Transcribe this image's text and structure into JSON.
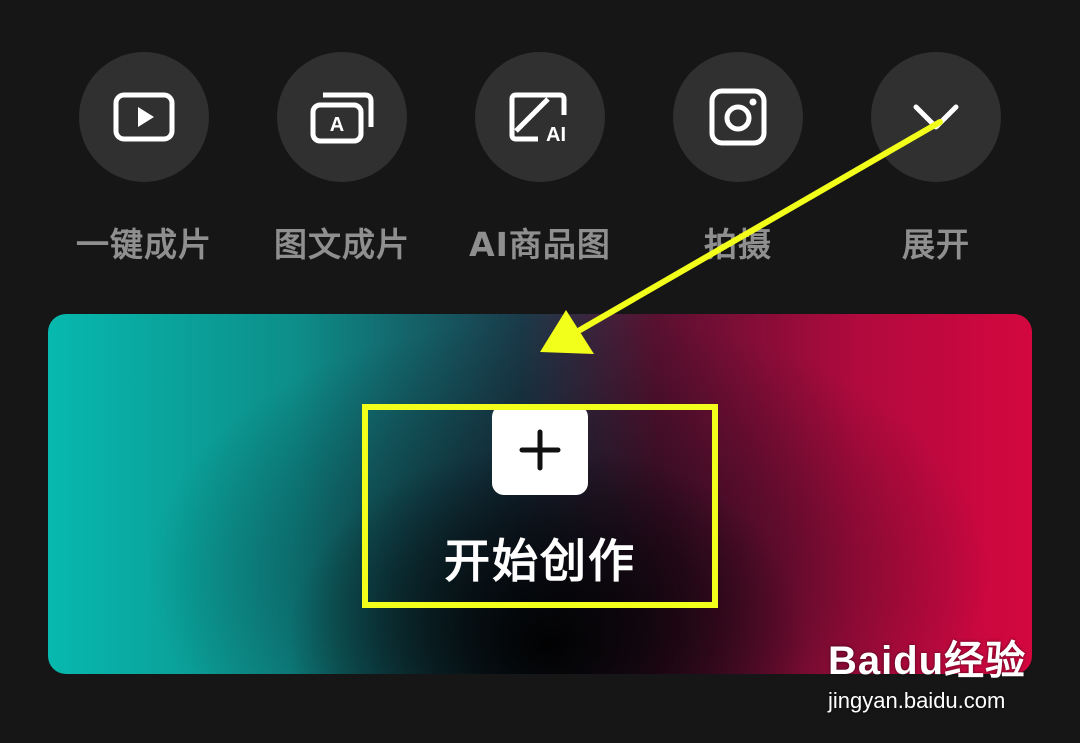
{
  "shortcuts": [
    {
      "label": "一键成片",
      "icon": "play-video-icon"
    },
    {
      "label": "图文成片",
      "icon": "text-image-icon"
    },
    {
      "label": "AI商品图",
      "icon": "ai-image-icon"
    },
    {
      "label": "拍摄",
      "icon": "camera-icon"
    },
    {
      "label": "展开",
      "icon": "chevron-down-icon"
    }
  ],
  "create": {
    "label": "开始创作",
    "icon": "plus-icon"
  },
  "annotation": {
    "color": "#f2ff1a"
  },
  "watermark": {
    "logo": "Baidu经验",
    "url": "jingyan.baidu.com"
  },
  "colors": {
    "background": "#161616",
    "circle": "#303030",
    "label": "#8f8f8f",
    "banner_left": "#07b9ae",
    "banner_right": "#d4073f"
  }
}
